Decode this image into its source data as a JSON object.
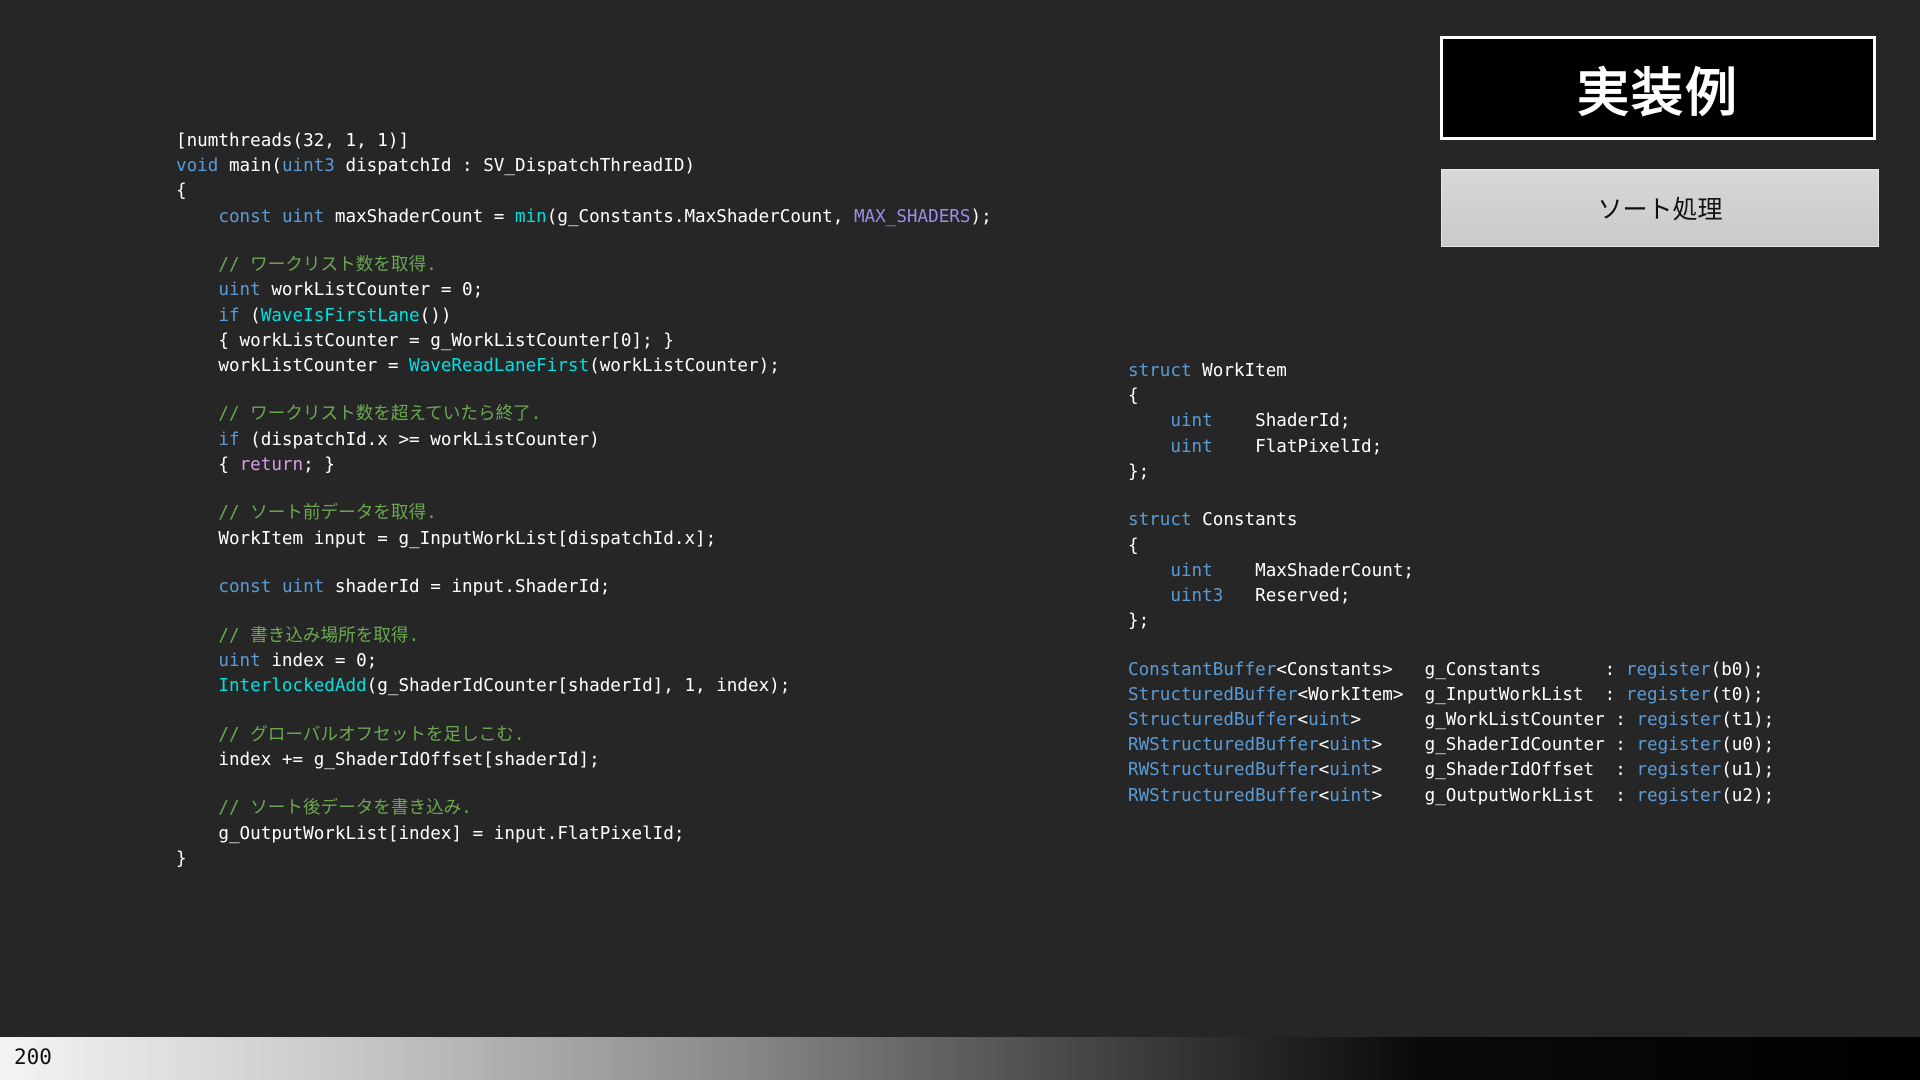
{
  "slide": {
    "title": "実装例",
    "subtitle": "ソート処理",
    "page_number": "200"
  },
  "main_code": {
    "l01": "[numthreads(32, 1, 1)]",
    "l02_kw": "void",
    "l02_a": " main(",
    "l02_type": "uint3",
    "l02_b": " dispatchId : SV_DispatchThreadID)",
    "l03": "{",
    "l04_kw1": "const",
    "l04_kw2": "uint",
    "l04_a": " maxShaderCount = ",
    "l04_fn": "min",
    "l04_b": "(g_Constants.MaxShaderCount, ",
    "l04_macro": "MAX_SHADERS",
    "l04_c": ");",
    "c1": "// ワークリスト数を取得.",
    "l05_kw": "uint",
    "l05_a": " workListCounter = 0;",
    "l06_kw": "if",
    "l06_a": " (",
    "l06_fn": "WaveIsFirstLane",
    "l06_b": "())",
    "l07": "{ workListCounter = g_WorkListCounter[0]; }",
    "l08_a": "workListCounter = ",
    "l08_fn": "WaveReadLaneFirst",
    "l08_b": "(workListCounter);",
    "c2": "// ワークリスト数を超えていたら終了.",
    "l09_kw": "if",
    "l09_a": " (dispatchId.x >= workListCounter)",
    "l10_a": "{ ",
    "l10_ret": "return",
    "l10_b": "; }",
    "c3": "// ソート前データを取得.",
    "l11": "WorkItem input = g_InputWorkList[dispatchId.x];",
    "l12_kw1": "const",
    "l12_kw2": "uint",
    "l12_a": " shaderId = input.ShaderId;",
    "c4": "// 書き込み場所を取得.",
    "l13_kw": "uint",
    "l13_a": " index = 0;",
    "l14_fn": "InterlockedAdd",
    "l14_a": "(g_ShaderIdCounter[shaderId], 1, index);",
    "c5": "// グローバルオフセットを足しこむ.",
    "l15": "index += g_ShaderIdOffset[shaderId];",
    "c6": "// ソート後データを書き込み.",
    "l16": "g_OutputWorkList[index] = input.FlatPixelId;",
    "l17": "}"
  },
  "decl_code": {
    "s1_kw": "struct",
    "s1_name": " WorkItem",
    "s1_open": "{",
    "s1_f1_type": "uint",
    "s1_f1_name": "    ShaderId;",
    "s1_f2_type": "uint",
    "s1_f2_name": "    FlatPixelId;",
    "s1_close": "};",
    "s2_kw": "struct",
    "s2_name": " Constants",
    "s2_open": "{",
    "s2_f1_type": "uint",
    "s2_f1_name": "    MaxShaderCount;",
    "s2_f2_type": "uint3",
    "s2_f2_name": "   Reserved;",
    "s2_close": "};",
    "buffers": [
      {
        "type": "ConstantBuffer",
        "arg_pre": "<",
        "arg_kw": "",
        "arg_text": "Constants",
        "arg_post": ">   ",
        "name": "g_Constants      : ",
        "reg": "register",
        "slot": "(b0);"
      },
      {
        "type": "StructuredBuffer",
        "arg_pre": "<",
        "arg_kw": "",
        "arg_text": "WorkItem",
        "arg_post": ">  ",
        "name": "g_InputWorkList  : ",
        "reg": "register",
        "slot": "(t0);"
      },
      {
        "type": "StructuredBuffer",
        "arg_pre": "<",
        "arg_kw": "uint",
        "arg_text": "",
        "arg_post": ">      ",
        "name": "g_WorkListCounter : ",
        "reg": "register",
        "slot": "(t1);"
      },
      {
        "type": "RWStructuredBuffer",
        "arg_pre": "<",
        "arg_kw": "uint",
        "arg_text": "",
        "arg_post": ">    ",
        "name": "g_ShaderIdCounter : ",
        "reg": "register",
        "slot": "(u0);"
      },
      {
        "type": "RWStructuredBuffer",
        "arg_pre": "<",
        "arg_kw": "uint",
        "arg_text": "",
        "arg_post": ">    ",
        "name": "g_ShaderIdOffset  : ",
        "reg": "register",
        "slot": "(u1);"
      },
      {
        "type": "RWStructuredBuffer",
        "arg_pre": "<",
        "arg_kw": "uint",
        "arg_text": "",
        "arg_post": ">    ",
        "name": "g_OutputWorkList  : ",
        "reg": "register",
        "slot": "(u2);"
      }
    ]
  },
  "colors": {
    "background": "#262627",
    "keyword": "#5b9bd5",
    "function": "#00e0e0",
    "comment": "#6aa84f",
    "return": "#d69ee8",
    "macro": "#9b8de8"
  }
}
